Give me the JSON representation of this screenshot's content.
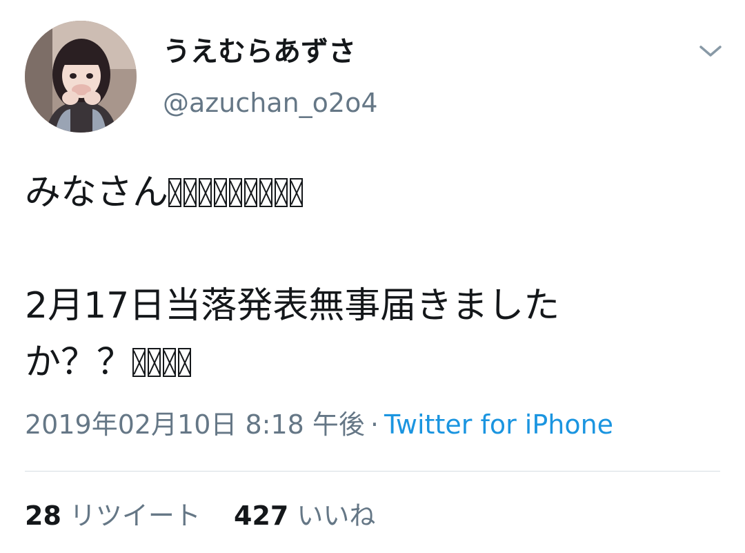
{
  "author": {
    "display_name": "うえむらあずさ",
    "handle": "@azuchan_o2o4"
  },
  "tweet": {
    "line1_text": "みなさん",
    "line1_unrendered_glyphs": 9,
    "line3_text": "2月17日当落発表無事届きました",
    "line4_text": "か？？",
    "line4_unrendered_glyphs": 4
  },
  "meta": {
    "timestamp": "2019年02月10日 8:18 午後",
    "separator": "·",
    "source": "Twitter for iPhone"
  },
  "stats": {
    "retweets_count": "28",
    "retweets_label": "リツイート",
    "likes_count": "427",
    "likes_label": "いいね"
  },
  "icons": {
    "menu": "chevron-down-icon"
  },
  "colors": {
    "text": "#14171a",
    "secondary": "#657786",
    "link": "#1b95e0",
    "divider": "#d6dde3"
  }
}
